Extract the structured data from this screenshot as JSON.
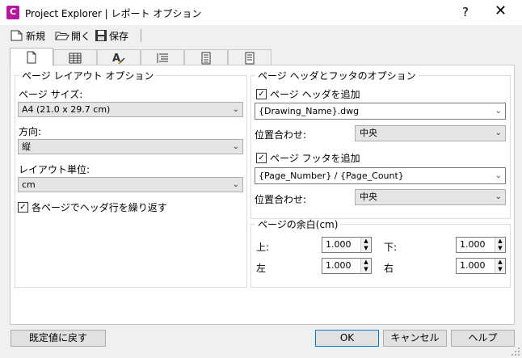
{
  "window": {
    "title": "Project Explorer | レポート オプション",
    "help": "?",
    "close": "✕",
    "app_icon_letter": "C"
  },
  "toolbar": {
    "new_label": "新規",
    "open_label": "開く",
    "save_label": "保存"
  },
  "tabs": [
    {
      "icon": "page-icon",
      "active": true
    },
    {
      "icon": "table-icon"
    },
    {
      "icon": "text-style-icon"
    },
    {
      "icon": "list-icon"
    },
    {
      "icon": "document-icon"
    },
    {
      "icon": "document-alt-icon"
    }
  ],
  "layout": {
    "group_title": "ページ レイアウト オプション",
    "page_size_label": "ページ サイズ:",
    "page_size_value": "A4 (21.0 x 29.7 cm)",
    "orientation_label": "方向:",
    "orientation_value": "縦",
    "units_label": "レイアウト単位:",
    "units_value": "cm",
    "repeat_header_label": "各ページでヘッダ行を繰り返す",
    "repeat_header_checked": true
  },
  "header_footer": {
    "group_title": "ページ ヘッダとフッタのオプション",
    "add_header_label": "ページ ヘッダを追加",
    "add_header_checked": true,
    "header_value": "{Drawing_Name}.dwg",
    "header_align_label": "位置合わせ:",
    "header_align_value": "中央",
    "add_footer_label": "ページ フッタを追加",
    "add_footer_checked": true,
    "footer_value": "{Page_Number} / {Page_Count}",
    "footer_align_label": "位置合わせ:",
    "footer_align_value": "中央"
  },
  "margins": {
    "group_title": "ページの余白(cm)",
    "top_label": "上:",
    "top_value": "1.000",
    "bottom_label": "下:",
    "bottom_value": "1.000",
    "left_label": "左",
    "left_value": "1.000",
    "right_label": "右",
    "right_value": "1.000"
  },
  "footer_buttons": {
    "reset": "既定値に戻す",
    "ok": "OK",
    "cancel": "キャンセル",
    "help": "ヘルプ"
  },
  "colors": {
    "app_icon": "#b5179e",
    "default_button_border": "#0078d7"
  }
}
